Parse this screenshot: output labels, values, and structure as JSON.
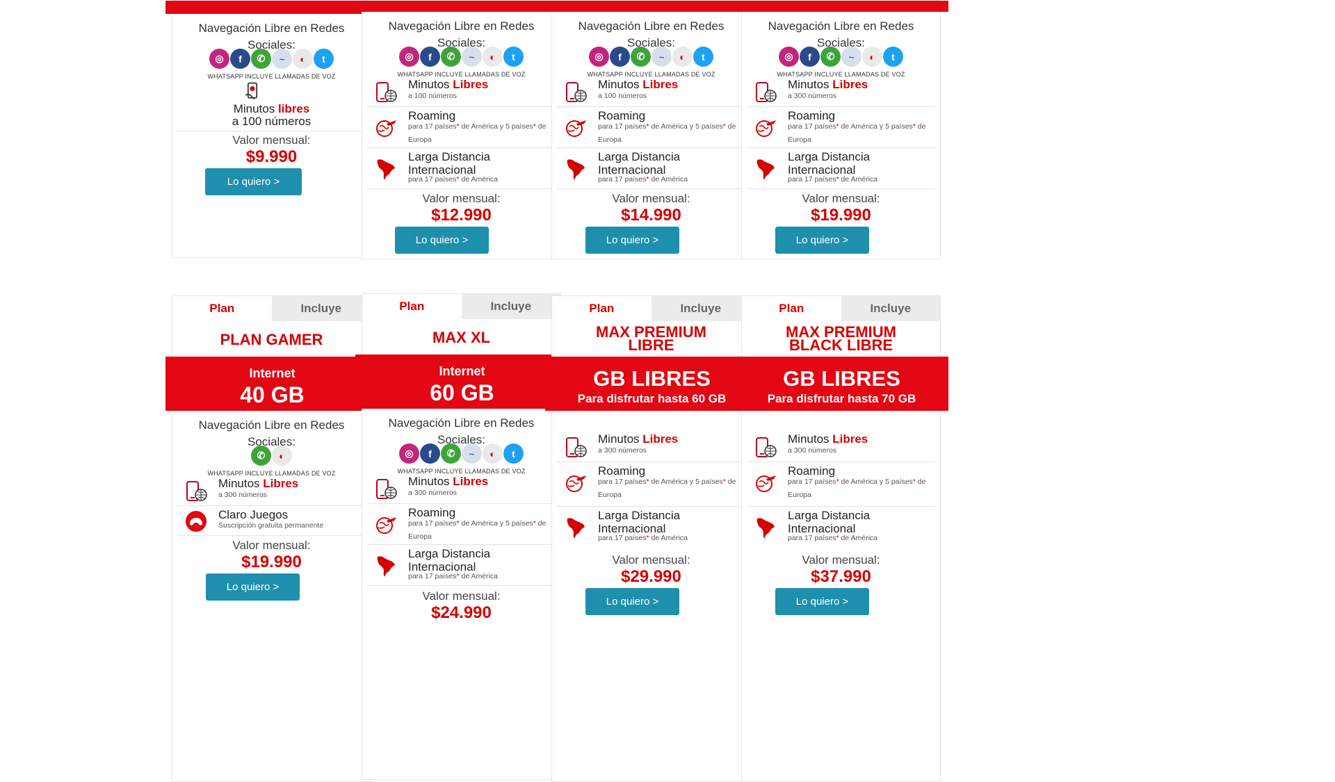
{
  "common": {
    "tab_plan": "Plan",
    "tab_incluye": "Incluye",
    "social_title": "Navegación Libre en Redes Sociales:",
    "wa_note": "WHATSAPP INCLUYE LLAMADAS DE VOZ",
    "valor_label": "Valor mensual:",
    "button_label": "Lo quiero >",
    "minutos_prefix": "Minutos ",
    "minutos_libres": "Libres",
    "roaming_title": "Roaming",
    "roaming_sub_a": "para 17 países",
    "roaming_sub_b": " de América y 5 países",
    "roaming_sub_c": " de Europa",
    "ld_title_1": "Larga Distancia",
    "ld_title_2": "Internacional",
    "ld_sub_a": "para 17 países",
    "ld_sub_b": " de América",
    "asterisk": "*"
  },
  "top_cards": [
    {
      "minutos_a": "Minutos ",
      "minutos_b": "libres",
      "minutos_c": "a 100 números",
      "price": "$9.990"
    },
    {
      "min_sub": "a 100 números",
      "price": "$12.990"
    },
    {
      "min_sub": "a 100 números",
      "price": "$14.990"
    },
    {
      "min_sub": "a 300 números",
      "price": "$19.990"
    }
  ],
  "bottom_cards": [
    {
      "name": "PLAN GAMER",
      "band_1": "Internet",
      "band_2": "40 GB",
      "min_sub": "a 300 números",
      "juegos_title": "Claro Juegos",
      "juegos_sub": "Suscripción gratuita permanente",
      "price": "$19.990"
    },
    {
      "name": "MAX XL",
      "band_1": "Internet",
      "band_2": "60 GB",
      "min_sub": "a 300 números",
      "price": "$24.990"
    },
    {
      "name_1": "MAX PREMIUM",
      "name_2": "LIBRE",
      "band_1": "GB LIBRES",
      "band_2": "Para disfrutar hasta 60 GB",
      "min_sub": "a 300 números",
      "price": "$29.990"
    },
    {
      "name_1": "MAX PREMIUM",
      "name_2": "BLACK LIBRE",
      "band_1": "GB LIBRES",
      "band_2": "Para disfrutar hasta 70 GB",
      "min_sub": "a 300 números",
      "price": "$37.990"
    }
  ],
  "colors": {
    "brand_red": "#e30613",
    "button_blue": "#1e90ae"
  }
}
